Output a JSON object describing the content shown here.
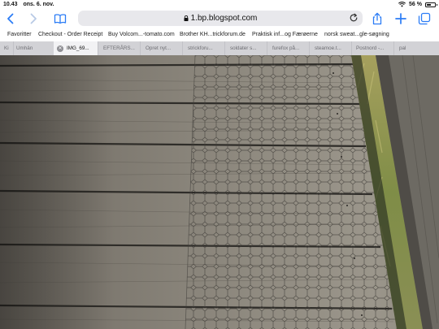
{
  "status": {
    "time": "10.43",
    "date": "ons. 6. nov.",
    "battery_text": "56 %",
    "battery_level": 0.56
  },
  "toolbar": {
    "back_icon": "chevron-left-icon",
    "forward_icon": "chevron-right-icon",
    "bookmarks_icon": "open-book-icon",
    "address": "1.bp.blogspot.com",
    "reload_icon": "reload-icon",
    "share_icon": "share-icon",
    "new_tab_icon": "plus-icon",
    "tabs_icon": "tabs-icon",
    "accent": "#2b7cf6"
  },
  "favorites": [
    "Favoritter",
    "Checkout - Order Receipt",
    "Buy Volcom...-tomato.com",
    "Brother KH...trickforum.de",
    "Praktisk inf...og Færøerne",
    "norsk sweat...gle-søgning"
  ],
  "tabs": [
    "Ki",
    "Umhän",
    "IMG_69...",
    "EFTERÅRS...",
    "Opret nyt...",
    "strickforu...",
    "soldater s...",
    "furefox på...",
    "steamoe.t...",
    "Postnord -...",
    "pal"
  ]
}
